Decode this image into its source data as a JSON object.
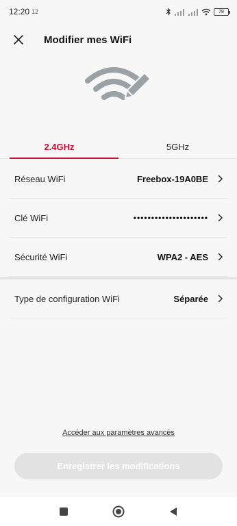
{
  "status_bar": {
    "time": "12:20",
    "extra": "12",
    "battery": "78",
    "icons": [
      "bluetooth-icon",
      "signal-icon",
      "signal-icon",
      "wifi-icon",
      "battery-icon"
    ]
  },
  "header": {
    "title": "Modifier mes WiFi",
    "close_icon": "close-icon"
  },
  "hero": {
    "icon": "wifi-edit-icon"
  },
  "tabs": [
    {
      "label": "2.4GHz",
      "active": true
    },
    {
      "label": "5GHz",
      "active": false
    }
  ],
  "settings": [
    {
      "label": "Réseau WiFi",
      "value": "Freebox-19A0BE"
    },
    {
      "label": "Clé WiFi",
      "value": "•••••••••••••••••••••"
    },
    {
      "label": "Sécurité WiFi",
      "value": "WPA2 - AES"
    }
  ],
  "config": {
    "label": "Type de configuration WiFi",
    "value": "Séparée"
  },
  "advanced_link": "Accéder aux paramètres avancés",
  "save_button": "Enregistrer les modifications",
  "colors": {
    "accent": "#c8102e",
    "disabled_button": "#e2e2e2",
    "icon_gray": "#9aa2a6"
  }
}
